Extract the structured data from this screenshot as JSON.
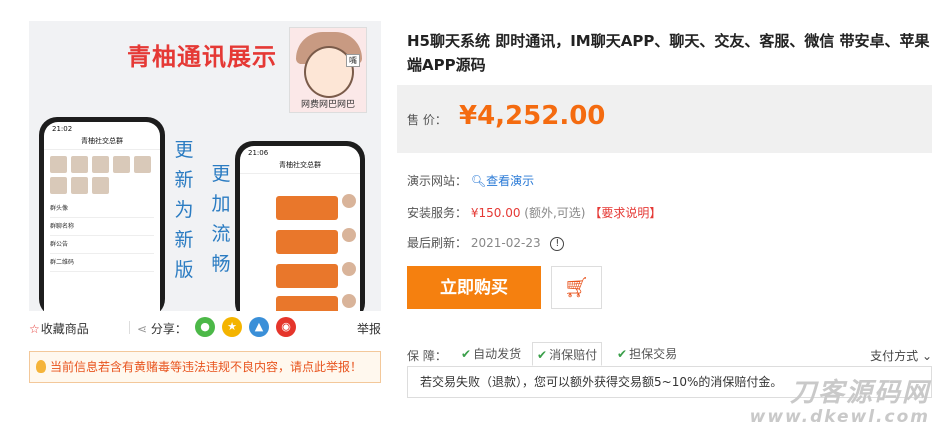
{
  "image": {
    "banner_title": "青柚通讯展示",
    "vertical_text_1": "更新为新版",
    "vertical_text_2": "更加流畅",
    "avatar_caption": "网费网巴网巴",
    "avatar_tag": "嘴",
    "phone_left": {
      "time": "21:02",
      "title": "青柚社交总群",
      "rows": [
        "群头像",
        "群聊名称",
        "群公告",
        "群二维码"
      ]
    },
    "phone_right": {
      "time": "21:06",
      "title": "青柚社交总群"
    }
  },
  "actions": {
    "collect_label": "收藏商品",
    "share_label": "分享：",
    "report_label": "举报"
  },
  "notice": {
    "text": "当前信息若含有黄赌毒等违法违规不良内容，请点此举报！"
  },
  "product": {
    "title": "H5聊天系统 即时通讯，IM聊天APP、聊天、交友、客服、微信 带安卓、苹果端APP源码",
    "price_label": "售 价：",
    "price": "¥4,252.00",
    "demo_label": "演示网站：",
    "demo_link": "查看演示",
    "install_label": "安装服务：",
    "install_fee": "¥150.00",
    "install_note": "(额外,可选)",
    "install_req": "【要求说明】",
    "refresh_label": "最后刷新：",
    "refresh_date": "2021-02-23",
    "buy_label": "立即购买"
  },
  "guarantee": {
    "label": "保 障：",
    "items": [
      "自动发货",
      "消保赔付",
      "担保交易"
    ],
    "pay_mode": "支付方式",
    "panel_text": "若交易失败（退款），您可以额外获得交易额5~10%的消保赔付金。"
  },
  "watermark": {
    "line1": "刀客源码网",
    "line2": "www.dkewl.com"
  },
  "colors": {
    "accent": "#f5800f",
    "price": "#f46b10",
    "link": "#2a7ad6",
    "warning": "#e8541e"
  }
}
